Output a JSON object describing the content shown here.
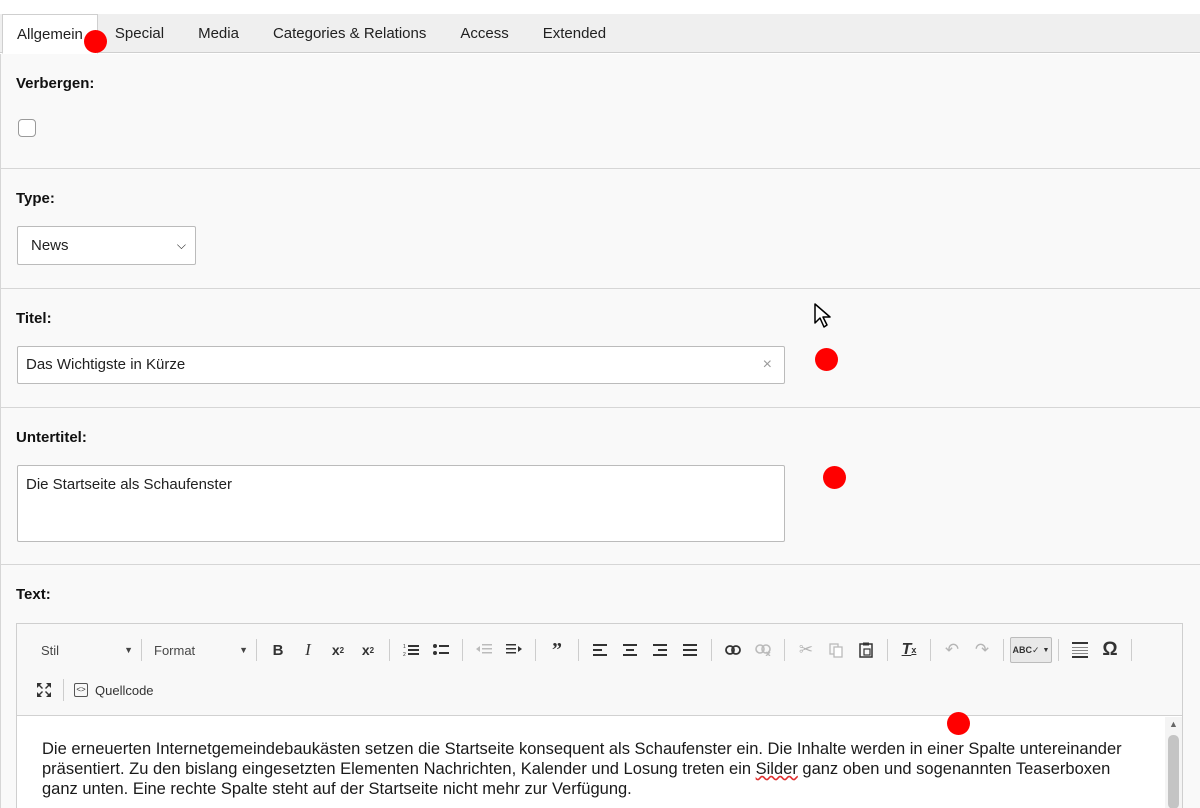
{
  "tabs": [
    "Allgemein",
    "Special",
    "Media",
    "Categories & Relations",
    "Access",
    "Extended"
  ],
  "fields": {
    "hide": {
      "label": "Verbergen:",
      "checked": false
    },
    "type": {
      "label": "Type:",
      "value": "News"
    },
    "title": {
      "label": "Titel:",
      "value": "Das Wichtigste in Kürze"
    },
    "subtitle": {
      "label": "Untertitel:",
      "value": "Die Startseite als Schaufenster"
    },
    "text": {
      "label": "Text:"
    }
  },
  "editor": {
    "style_combo": "Stil",
    "format_combo": "Format",
    "source_label": "Quellcode",
    "content_before": "Die erneuerten Internetgemeindebaukästen setzen die Startseite konsequent als Schaufenster ein. Die Inhalte werden in einer Spalte untereinander präsentiert. Zu den bislang eingesetzten Elementen Nachrichten, Kalender und Losung treten ein ",
    "content_misspelled": "Silder",
    "content_after": " ganz oben und sogenannten Teaserboxen ganz unten. Eine rechte Spalte steht auf der Startseite nicht mehr zur Verfügung."
  },
  "colors": {
    "marker": "#ff0000",
    "panel_bg": "#f9f9f9"
  }
}
